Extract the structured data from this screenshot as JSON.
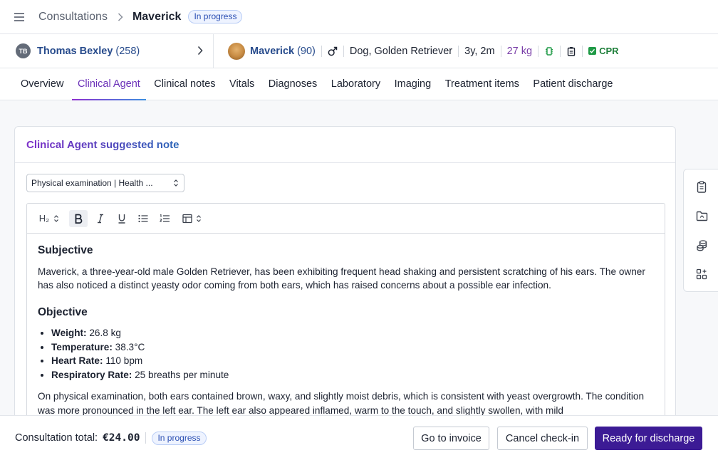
{
  "header": {
    "breadcrumb_root": "Consultations",
    "breadcrumb_current": "Maverick",
    "status": "In progress"
  },
  "client": {
    "initials": "TB",
    "name": "Thomas Bexley",
    "count": "(258)"
  },
  "patient": {
    "name": "Maverick",
    "count": "(90)",
    "sex_icon": "male-symbol",
    "species_breed": "Dog, Golden Retriever",
    "age": "3y, 2m",
    "weight": "27 kg",
    "cpr_label": "CPR"
  },
  "tabs": [
    {
      "label": "Overview"
    },
    {
      "label": "Clinical Agent"
    },
    {
      "label": "Clinical notes"
    },
    {
      "label": "Vitals"
    },
    {
      "label": "Diagnoses"
    },
    {
      "label": "Laboratory"
    },
    {
      "label": "Imaging"
    },
    {
      "label": "Treatment items"
    },
    {
      "label": "Patient discharge"
    }
  ],
  "active_tab": "Clinical Agent",
  "card": {
    "title": "Clinical Agent suggested note",
    "template_select": "Physical examination | Health ..."
  },
  "toolbar": {
    "heading_label": "H₂"
  },
  "note": {
    "subjective_heading": "Subjective",
    "subjective_text": "Maverick, a three-year-old male Golden Retriever, has been exhibiting frequent head shaking and persistent scratching of his ears. The owner has also noticed a distinct yeasty odor coming from both ears, which has raised concerns about a possible ear infection.",
    "objective_heading": "Objective",
    "vitals": [
      {
        "label": "Weight:",
        "value": "26.8 kg"
      },
      {
        "label": "Temperature:",
        "value": "38.3°C"
      },
      {
        "label": "Heart Rate:",
        "value": "110 bpm"
      },
      {
        "label": "Respiratory Rate:",
        "value": "25 breaths per minute"
      }
    ],
    "exam_text": "On physical examination, both ears contained brown, waxy, and slightly moist debris, which is consistent with yeast overgrowth. The condition was more pronounced in the left ear. The left ear also appeared inflamed, warm to the touch, and slightly swollen, with mild"
  },
  "footer": {
    "total_label": "Consultation total:",
    "total_value": "€24.00",
    "status": "In progress",
    "invoice_button": "Go to invoice",
    "cancel_button": "Cancel check-in",
    "discharge_button": "Ready for discharge"
  },
  "colors": {
    "accent": "#3c1b95",
    "link": "#274b8c",
    "tab_active": "#6a2fb8",
    "cpr_green": "#1f9a46",
    "weight_purple": "#7a3fa8"
  }
}
